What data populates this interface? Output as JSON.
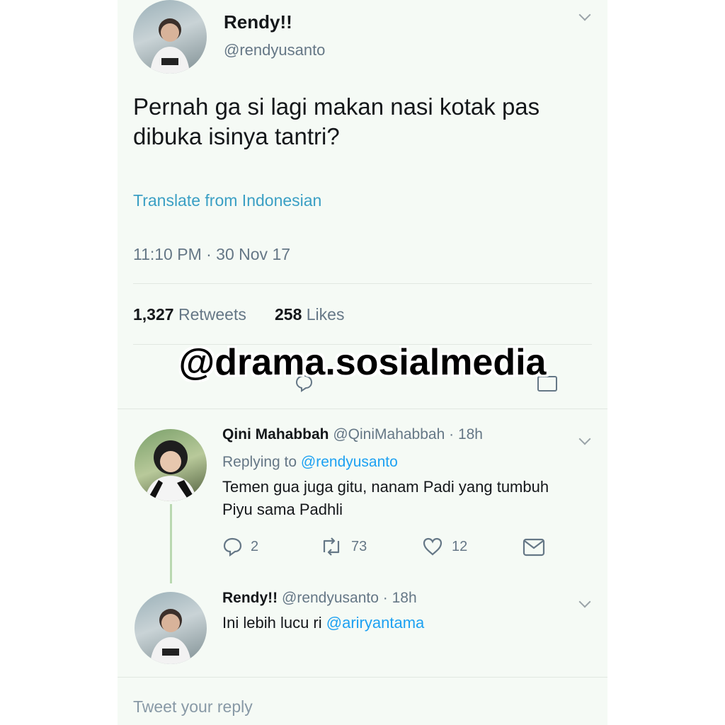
{
  "tweet": {
    "display_name": "Rendy!!",
    "handle": "@rendyusanto",
    "text_line1": "Pernah ga si lagi makan nasi kotak pas",
    "text_line2": "dibuka isinya tantri?",
    "translate_label": "Translate from Indonesian",
    "timestamp": "11:10 PM · 30 Nov 17",
    "retweet_count": "1,327",
    "retweet_label": "Retweets",
    "like_count": "258",
    "like_label": "Likes"
  },
  "watermark": "@drama.sosialmedia",
  "reply1": {
    "display_name": "Qini Mahabbah",
    "handle": "@QiniMahabbah",
    "age": "· 18h",
    "replying_prefix": "Replying to",
    "replying_handle": "@rendyusanto",
    "text_line1": "Temen gua juga gitu, nanam Padi yang tumbuh",
    "text_line2": "Piyu sama Padhli",
    "reply_count": "2",
    "retweet_count": "73",
    "like_count": "12"
  },
  "reply2": {
    "display_name": "Rendy!!",
    "handle": "@rendyusanto",
    "age": "· 18h",
    "text_prefix": "Ini lebih lucu ri",
    "mention": "@ariryantama"
  },
  "compose": {
    "placeholder": "Tweet your reply"
  },
  "colors": {
    "link": "#1da1f2",
    "translate": "#3a9fc4",
    "thread_line": "#b9d8b0",
    "background": "#f5faf5"
  },
  "icons": [
    "chevron-down-icon",
    "reply-icon",
    "retweet-icon",
    "heart-icon",
    "mail-icon"
  ]
}
